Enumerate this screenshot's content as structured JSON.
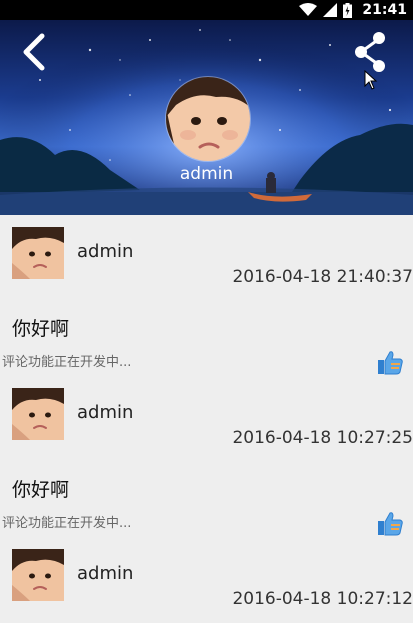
{
  "statusbar": {
    "time": "21:41"
  },
  "header": {
    "username": "admin"
  },
  "posts": [
    {
      "author": "admin",
      "time": "2016-04-18 21:40:37",
      "title": "你好啊",
      "comment": "评论功能正在开发中..."
    },
    {
      "author": "admin",
      "time": "2016-04-18 10:27:25",
      "title": "你好啊",
      "comment": "评论功能正在开发中..."
    },
    {
      "author": "admin",
      "time": "2016-04-18 10:27:12"
    }
  ],
  "colors": {
    "header_sky": "#1b3c8f",
    "list_bg": "#eeeeee",
    "like_blue": "#3a8fd9"
  }
}
